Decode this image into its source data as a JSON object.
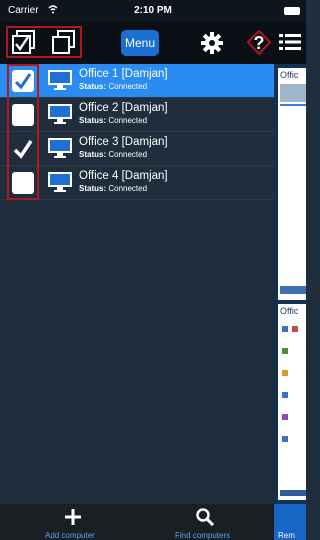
{
  "status_bar": {
    "carrier": "Carrier",
    "time": "2:10 PM"
  },
  "toolbar": {
    "menu_label": "Menu"
  },
  "computers": [
    {
      "name": "Office 1 [Damjan]",
      "status_label": "Status:",
      "status_value": "Connected",
      "checked": true,
      "selected": true
    },
    {
      "name": "Office 2 [Damjan]",
      "status_label": "Status:",
      "status_value": "Connected",
      "checked": false,
      "selected": false
    },
    {
      "name": "Office 3 [Damjan]",
      "status_label": "Status:",
      "status_value": "Connected",
      "checked": true,
      "selected": false
    },
    {
      "name": "Office 4 [Damjan]",
      "status_label": "Status:",
      "status_value": "Connected",
      "checked": false,
      "selected": false
    }
  ],
  "preview": {
    "cards": [
      {
        "title": "Offic"
      },
      {
        "title": "Offic"
      }
    ]
  },
  "bottom_bar": {
    "add_label": "Add computer",
    "find_label": "Find computers",
    "right_label": "Rem"
  },
  "colors": {
    "accent": "#2a8bf0",
    "highlight_border": "#b11621",
    "link": "#58a2f0"
  }
}
